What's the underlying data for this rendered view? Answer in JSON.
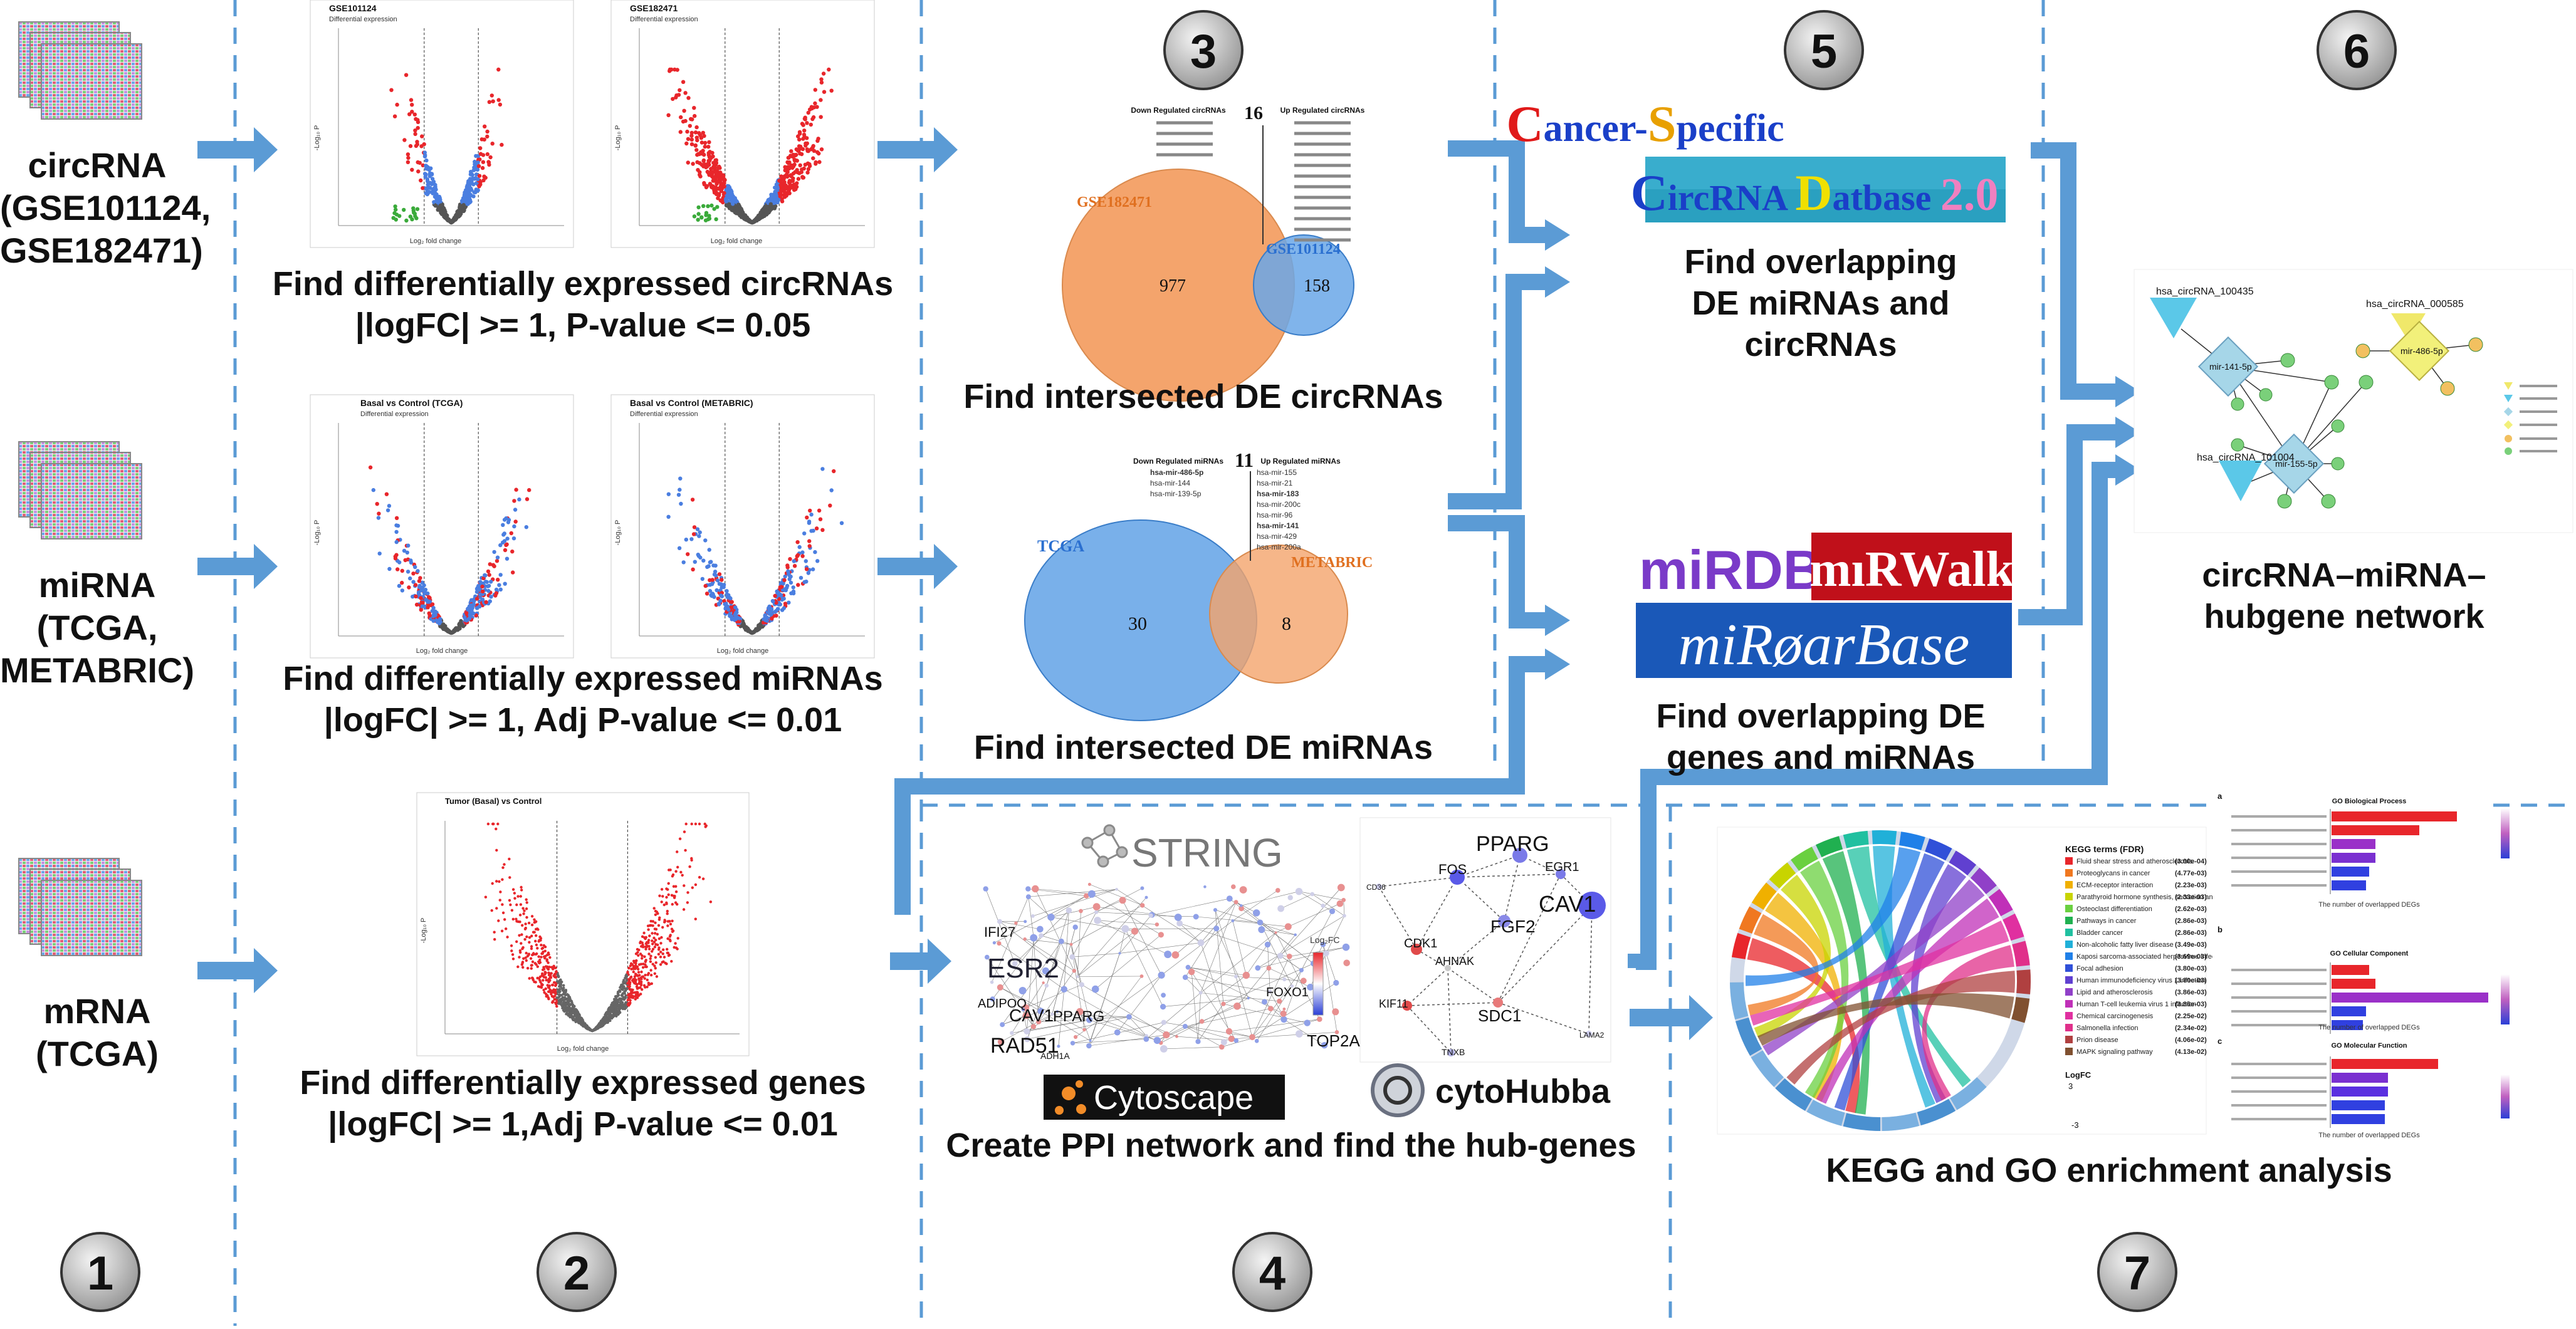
{
  "steps": [
    "1",
    "2",
    "3",
    "4",
    "5",
    "6",
    "7"
  ],
  "sources": {
    "circrna": [
      "circRNA",
      "(GSE101124,",
      "GSE182471)"
    ],
    "mirna": [
      "miRNA",
      "(TCGA,",
      "METABRIC)"
    ],
    "mrna": [
      "mRNA",
      "(TCGA)"
    ]
  },
  "captions": {
    "de_circ": [
      "Find differentially expressed circRNAs",
      "|logFC| >= 1, P-value <= 0.05"
    ],
    "de_mirna": [
      "Find differentially expressed miRNAs",
      "|logFC| >= 1, Adj P-value <= 0.01"
    ],
    "de_genes": [
      "Find differentially expressed genes",
      "|logFC| >= 1,Adj P-value <= 0.01"
    ],
    "int_circ": [
      "Find intersected DE circRNAs"
    ],
    "int_mirna": [
      "Find intersected DE miRNAs"
    ],
    "ppi": [
      "Create PPI network and find the hub-genes"
    ],
    "overlap_circ": [
      "Find overlapping",
      "DE miRNAs and",
      "circRNAs"
    ],
    "overlap_genes": [
      "Find overlapping DE",
      "genes  and miRNAs"
    ],
    "network": [
      "circRNA–miRNA–",
      "hubgene network"
    ],
    "enrich": [
      "KEGG and GO enrichment analysis"
    ]
  },
  "volcano_titles": {
    "gse101124": "GSE101124",
    "gse182471": "GSE182471",
    "tcga": "Basal vs Control (TCGA)",
    "metabric": "Basal vs Control (METABRIC)",
    "mrna": "Tumor (Basal) vs Control",
    "sub_diff": "Differential expression",
    "xlabel": "Log₂ fold change",
    "ylabel": "-Log₁₀ P"
  },
  "venn_circ": {
    "left_label": "GSE182471",
    "right_label": "GSE101124",
    "left_only": "977",
    "shared": "16",
    "right_only": "158",
    "down_header": "Down Regulated circRNAs",
    "up_header": "Up Regulated circRNAs"
  },
  "venn_mirna": {
    "left_label": "TCGA",
    "right_label": "METABRIC",
    "left_only": "30",
    "shared": "11",
    "right_only": "8",
    "down_header": "Down Regulated miRNAs",
    "up_header": "Up Regulated miRNAs",
    "down_list": [
      "hsa-mir-486-5p",
      "hsa-mir-144",
      "hsa-mir-139-5p"
    ],
    "up_list": [
      "hsa-mir-155",
      "hsa-mir-21",
      "hsa-mir-183",
      "hsa-mir-200c",
      "hsa-mir-96",
      "hsa-mir-141",
      "hsa-mir-429",
      "hsa-mir-200a"
    ]
  },
  "databases": {
    "csc_line1": [
      "C",
      "ancer-",
      "S",
      "pecific"
    ],
    "csc_line2": [
      "C",
      "ircRNA ",
      "D",
      "atbase ",
      "2.0"
    ],
    "mirdb": "miRDB",
    "mirwalk": "mıRWalk",
    "mirbase": "miRøarBase"
  },
  "ppi_tools": {
    "string": "STRING",
    "cytoscape": "Cytoscape",
    "cytohubba": "cytoHubba",
    "legend_title": "Log₂FC",
    "net_nodes": [
      "PPARG",
      "FOS",
      "EGR1",
      "FGF2",
      "CAV1",
      "CDK1",
      "AHNAK",
      "KIF11",
      "SDC1",
      "TNXB",
      "CD36",
      "LAMA2"
    ],
    "left_labels": [
      "ESR2",
      "CAV1",
      "PPARG",
      "RAD51",
      "TOP2A",
      "IFI27",
      "ADIPOQ",
      "ADH1A",
      "FOXO1"
    ]
  },
  "network": {
    "circ_labels": [
      "hsa_circRNA_100435",
      "hsa_circRNA_000585",
      "hsa_circRNA_101004"
    ],
    "mirna_labels": [
      "mir-141-5p",
      "mir-155-5p",
      "mir-486-5p"
    ]
  },
  "enrichment": {
    "kegg_title": "KEGG terms (FDR)",
    "kegg_terms": [
      "Fluid shear stress and atherosclerosis",
      "Proteoglycans in cancer",
      "ECM-receptor interaction",
      "Parathyroid hormone synthesis, secretion and action",
      "Osteoclast differentiation",
      "Pathways in cancer",
      "Bladder cancer",
      "Non-alcoholic fatty liver disease",
      "Kaposi sarcoma-associated herpesvirus infection",
      "Focal adhesion",
      "Human immunodeficiency virus 1 infection",
      "Lipid and atherosclerosis",
      "Human T-cell leukemia virus 1 infection",
      "Chemical carcinogenesis",
      "Salmonella infection",
      "Prion disease",
      "MAPK signaling pathway"
    ],
    "kegg_fdr": [
      "(3.00e-04)",
      "(4.77e-03)",
      "(2.23e-03)",
      "(2.33e-03)",
      "(2.62e-03)",
      "(2.86e-03)",
      "(2.86e-03)",
      "(3.49e-03)",
      "(3.69e-03)",
      "(3.80e-03)",
      "(3.80e-03)",
      "(3.86e-03)",
      "(3.86e-03)",
      "(2.25e-02)",
      "(2.34e-02)",
      "(4.06e-02)",
      "(4.13e-02)"
    ],
    "logfc_label": "LogFC",
    "logfc_max": "3",
    "logfc_min": "-3",
    "go_bp": "GO Biological Process",
    "go_cc": "GO Cellular Component",
    "go_mf": "GO Molecular Function",
    "panel_a": "a",
    "panel_b": "b",
    "panel_c": "c",
    "go_xlabel": "The number of overlapped DEGs"
  },
  "colors": {
    "arrow": "#5b9bd5",
    "dash": "#5b9bd5",
    "up": "#e8262b",
    "down": "#3a6fd8",
    "venn_orange": "#f4a46c",
    "venn_blue": "#6aa7e8",
    "circle_fill": "#d4d4d4"
  }
}
